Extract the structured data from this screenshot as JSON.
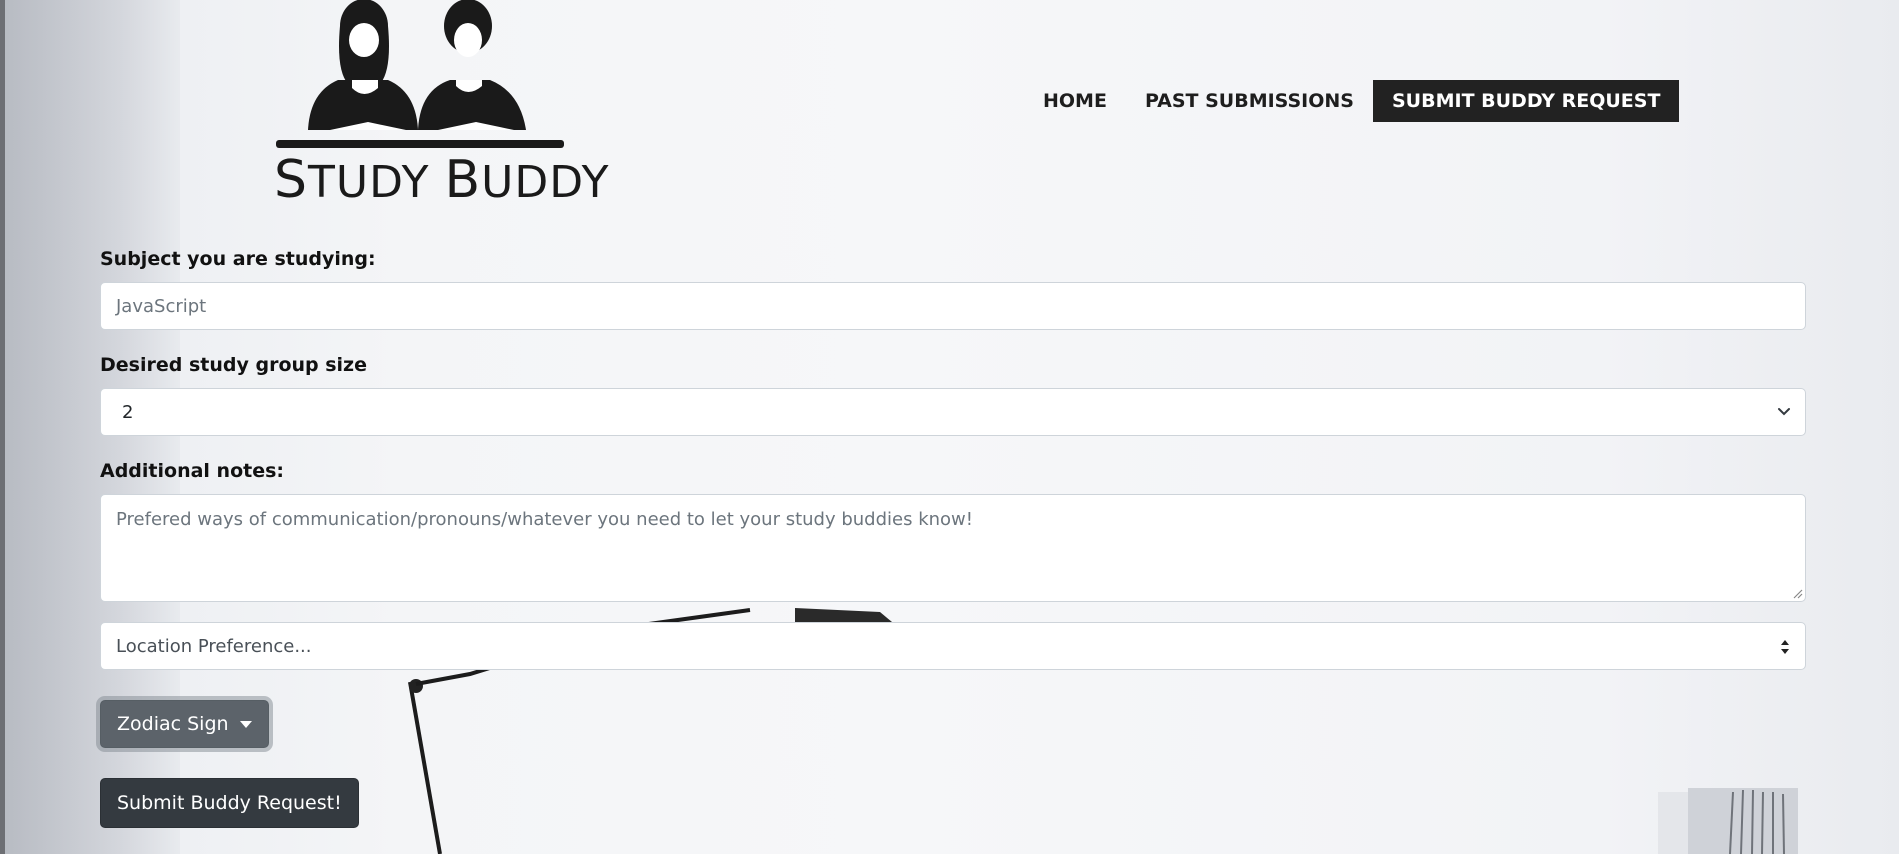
{
  "brand": {
    "logo_text_first": "S",
    "logo_text_1": "TUDY ",
    "logo_text_second": "B",
    "logo_text_2": "UDDY"
  },
  "nav": {
    "home": "HOME",
    "past_submissions": "PAST SUBMISSIONS",
    "submit_request": "SUBMIT BUDDY REQUEST"
  },
  "form": {
    "subject_label": "Subject you are studying:",
    "subject_placeholder": "JavaScript",
    "group_size_label": "Desired study group size",
    "group_size_value": "2",
    "notes_label": "Additional notes:",
    "notes_placeholder": "Prefered ways of communication/pronouns/whatever you need to let your study buddies know!",
    "location_value": "Location Preference...",
    "zodiac_label": "Zodiac Sign",
    "submit_label": "Submit Buddy Request!"
  },
  "colors": {
    "nav_active_bg": "#222222",
    "zodiac_button_bg": "#5c636a",
    "submit_button_bg": "#343a40"
  }
}
